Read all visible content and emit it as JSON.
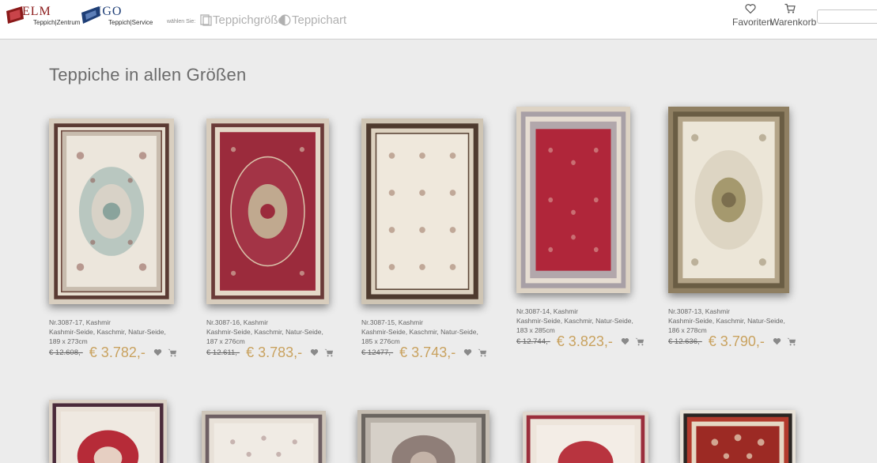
{
  "header": {
    "logo_helm": {
      "word": "ELM",
      "sub": "Teppich|Zentrum"
    },
    "logo_migo": {
      "word": "IGO",
      "sub": "Teppich|Service"
    },
    "choose_label": "wählen Sie:",
    "filter_size": "Teppichgröße",
    "filter_type": "Teppichart",
    "favorites_label": "Favoriten",
    "cart_label": "Warenkorb",
    "search_placeholder": ""
  },
  "page_title": "Teppiche in allen Größen",
  "colors": {
    "price_gold": "#c9a25f",
    "logo_red": "#8b1a1a",
    "logo_blue": "#1f3f77"
  },
  "products": [
    {
      "title": "Nr.3087-17, Kashmir",
      "material": "Kashmir-Seide, Kaschmir, Natur-Seide,",
      "size": "189 x 273cm",
      "old_price": "€ 12.608,-",
      "price": "€ 3.782,-",
      "pattern": "ivory-medallion"
    },
    {
      "title": "Nr.3087-16, Kashmir",
      "material": "Kashmir-Seide, Kaschmir, Natur-Seide,",
      "size": "187 x 276cm",
      "old_price": "€ 12.611,-",
      "price": "€ 3.783,-",
      "pattern": "red-medallion"
    },
    {
      "title": "Nr.3087-15, Kashmir",
      "material": "Kashmir-Seide, Kaschmir, Natur-Seide,",
      "size": "185 x 276cm",
      "old_price": "€ 12477,-",
      "price": "€ 3.743,-",
      "pattern": "ivory-allover"
    },
    {
      "title": "Nr.3087-14, Kashmir",
      "material": "Kashmir-Seide, Kaschmir, Natur-Seide,",
      "size": "183 x 285cm",
      "old_price": "€ 12.744,-",
      "price": "€ 3.823,-",
      "pattern": "red-allover"
    },
    {
      "title": "Nr.3087-13, Kashmir",
      "material": "Kashmir-Seide, Kaschmir, Natur-Seide,",
      "size": "186 x 278cm",
      "old_price": "€ 12.636,-",
      "price": "€ 3.790,-",
      "pattern": "green-medallion"
    }
  ],
  "second_row": [
    "ivory-red-medallion",
    "ivory-allover",
    "grey-medallion",
    "red-ivory",
    "dark-red"
  ]
}
